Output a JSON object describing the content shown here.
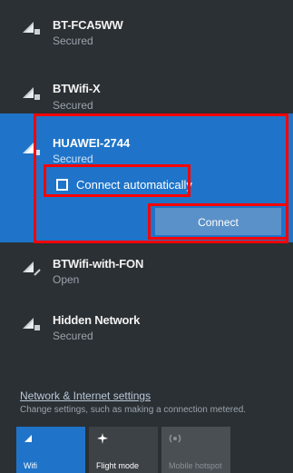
{
  "networks": [
    {
      "name": "BT-FCA5WW",
      "status": "Secured"
    },
    {
      "name": "BTWifi-X",
      "status": "Secured"
    },
    {
      "name": "HUAWEI-2744",
      "status": "Secured"
    },
    {
      "name": "BTWifi-with-FON",
      "status": "Open"
    },
    {
      "name": "Hidden Network",
      "status": "Secured"
    }
  ],
  "expanded": {
    "connect_auto_label": "Connect automatically",
    "connect_auto_checked": false,
    "connect_button": "Connect"
  },
  "settings": {
    "link": "Network & Internet settings",
    "description": "Change settings, such as making a connection metered."
  },
  "quick_actions": [
    {
      "label": "Wifi",
      "icon": "wifi-icon",
      "active": true
    },
    {
      "label": "Flight mode",
      "icon": "airplane-icon",
      "active": false
    },
    {
      "label": "Mobile hotspot",
      "icon": "hotspot-icon",
      "active": false
    }
  ],
  "colors": {
    "panel_bg": "#2b3035",
    "accent": "#1f74c9",
    "highlight": "#ff0000"
  }
}
